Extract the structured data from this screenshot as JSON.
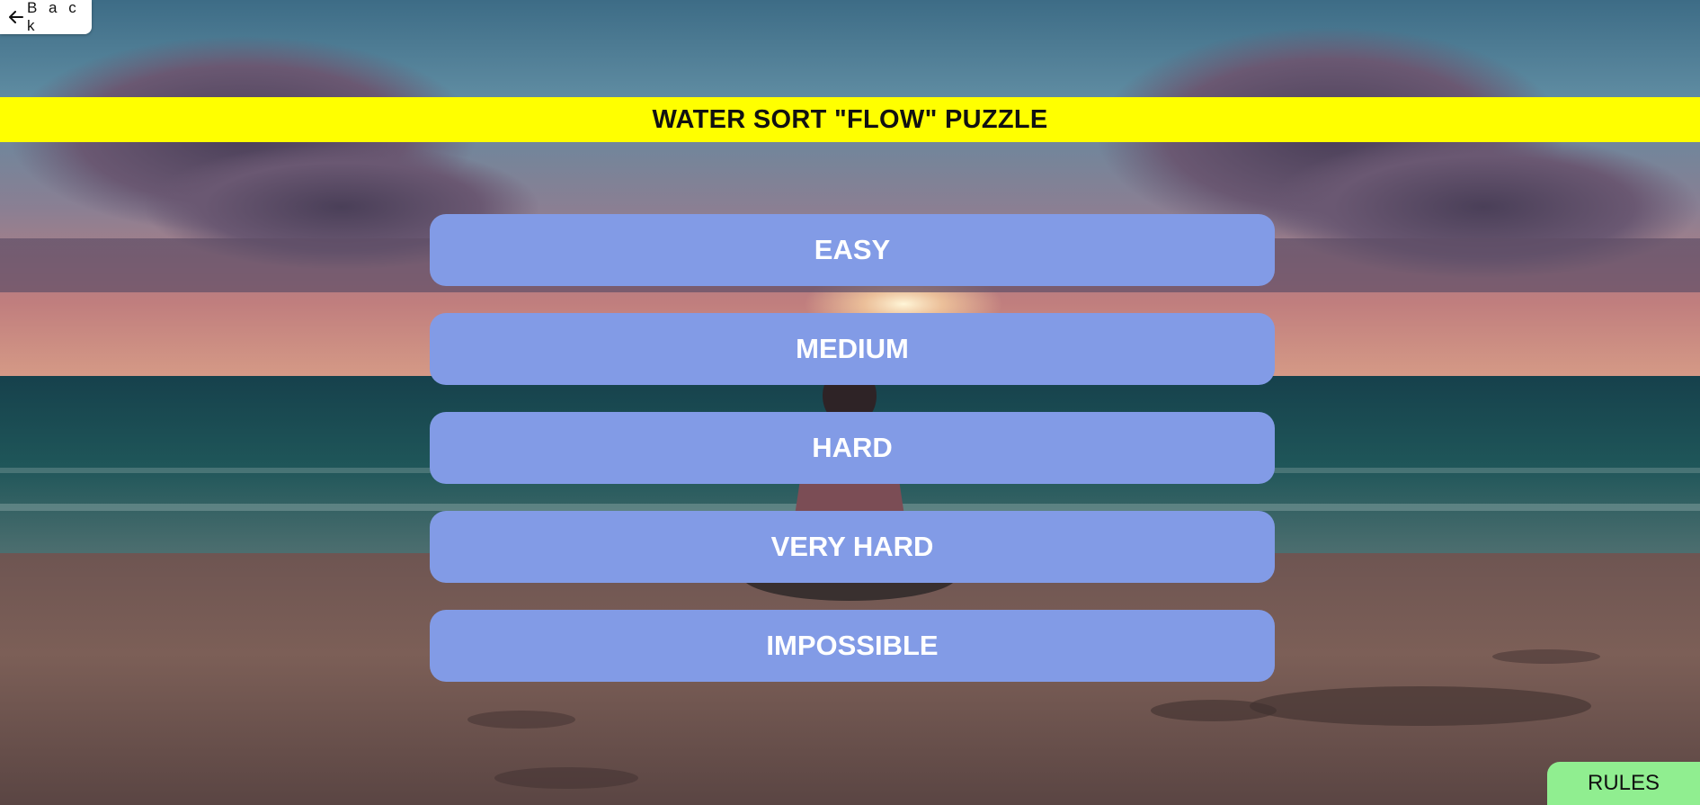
{
  "back_button": {
    "label": "B a c k",
    "icon": "arrow-left-icon"
  },
  "title": "WATER SORT \"FLOW\" PUZZLE",
  "levels": [
    {
      "label": "EASY"
    },
    {
      "label": "MEDIUM"
    },
    {
      "label": "HARD"
    },
    {
      "label": "VERY HARD"
    },
    {
      "label": "IMPOSSIBLE"
    }
  ],
  "rules_button": {
    "label": "RULES"
  },
  "colors": {
    "title_bar": "#ffff00",
    "level_button": "#829be6",
    "rules_button": "#90ee90"
  }
}
